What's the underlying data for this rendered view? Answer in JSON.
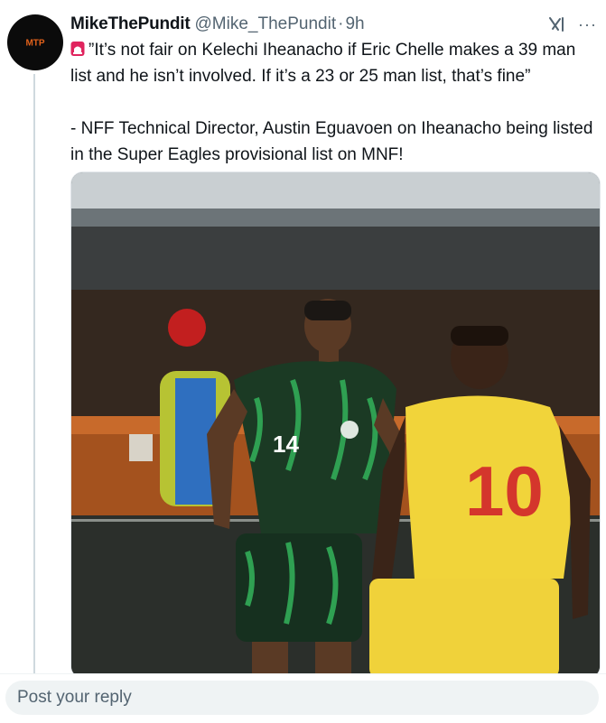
{
  "tweet": {
    "author_name": "MikeThePundit",
    "handle": "@Mike_ThePundit",
    "separator": "·",
    "time": "9h",
    "avatar_logo_text": "MTP",
    "more_label": "···",
    "paragraph1": "”It’s not fair on Kelechi Iheanacho if Eric Chelle makes a 39 man list and he isn’t involved. If it’s a 23 or 25 man list, that’s fine”",
    "paragraph2": "- NFF Technical Director, Austin Eguavoen on Iheanacho being listed in the Super Eagles provisional list on MNF!",
    "media": {
      "player1_number": "14",
      "player2_number": "10"
    }
  },
  "reply": {
    "placeholder": "Post your reply"
  },
  "icons": {
    "siren": "siren-icon",
    "grok": "grok-icon",
    "more": "more-icon"
  },
  "colors": {
    "text": "#0f1419",
    "secondary_text": "#536471",
    "reply_bg": "#eff3f4",
    "thread_line": "#cfd9de"
  }
}
